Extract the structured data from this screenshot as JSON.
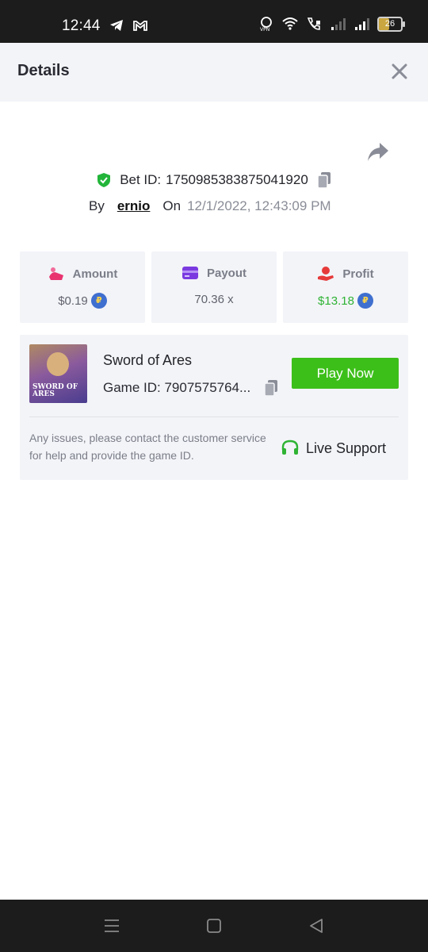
{
  "status_bar": {
    "time": "12:44",
    "battery": "26"
  },
  "header": {
    "title": "Details"
  },
  "bet": {
    "id_label": "Bet ID:",
    "id_value": "1750985383875041920",
    "by_label": "By",
    "user": "ernio",
    "on_label": "On",
    "date": "12/1/2022, 12:43:09 PM"
  },
  "stats": [
    {
      "label": "Amount",
      "value": "$0.19",
      "has_coin": true
    },
    {
      "label": "Payout",
      "value": "70.36 x",
      "has_coin": false
    },
    {
      "label": "Profit",
      "value": "$13.18",
      "has_coin": true
    }
  ],
  "game": {
    "name": "Sword of Ares",
    "id_text": "Game ID: 7907575764...",
    "thumb_text_line1": "SWORD OF",
    "thumb_text_line2": "ARES",
    "play_label": "Play Now",
    "help_text": "Any issues, please contact the customer service for help and provide the game ID.",
    "support_label": "Live Support"
  },
  "colors": {
    "accent_green": "#3dbf1a",
    "profit_green": "#2fb334",
    "panel_bg": "#f3f4f8"
  }
}
